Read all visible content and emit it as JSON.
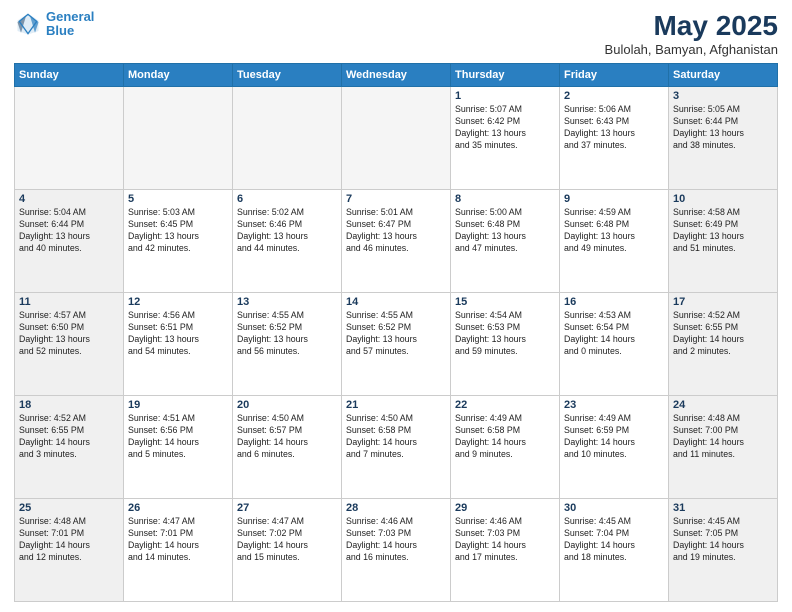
{
  "logo": {
    "line1": "General",
    "line2": "Blue"
  },
  "title": "May 2025",
  "subtitle": "Bulolah, Bamyan, Afghanistan",
  "days_of_week": [
    "Sunday",
    "Monday",
    "Tuesday",
    "Wednesday",
    "Thursday",
    "Friday",
    "Saturday"
  ],
  "weeks": [
    [
      {
        "day": "",
        "info": ""
      },
      {
        "day": "",
        "info": ""
      },
      {
        "day": "",
        "info": ""
      },
      {
        "day": "",
        "info": ""
      },
      {
        "day": "1",
        "info": "Sunrise: 5:07 AM\nSunset: 6:42 PM\nDaylight: 13 hours\nand 35 minutes."
      },
      {
        "day": "2",
        "info": "Sunrise: 5:06 AM\nSunset: 6:43 PM\nDaylight: 13 hours\nand 37 minutes."
      },
      {
        "day": "3",
        "info": "Sunrise: 5:05 AM\nSunset: 6:44 PM\nDaylight: 13 hours\nand 38 minutes."
      }
    ],
    [
      {
        "day": "4",
        "info": "Sunrise: 5:04 AM\nSunset: 6:44 PM\nDaylight: 13 hours\nand 40 minutes."
      },
      {
        "day": "5",
        "info": "Sunrise: 5:03 AM\nSunset: 6:45 PM\nDaylight: 13 hours\nand 42 minutes."
      },
      {
        "day": "6",
        "info": "Sunrise: 5:02 AM\nSunset: 6:46 PM\nDaylight: 13 hours\nand 44 minutes."
      },
      {
        "day": "7",
        "info": "Sunrise: 5:01 AM\nSunset: 6:47 PM\nDaylight: 13 hours\nand 46 minutes."
      },
      {
        "day": "8",
        "info": "Sunrise: 5:00 AM\nSunset: 6:48 PM\nDaylight: 13 hours\nand 47 minutes."
      },
      {
        "day": "9",
        "info": "Sunrise: 4:59 AM\nSunset: 6:48 PM\nDaylight: 13 hours\nand 49 minutes."
      },
      {
        "day": "10",
        "info": "Sunrise: 4:58 AM\nSunset: 6:49 PM\nDaylight: 13 hours\nand 51 minutes."
      }
    ],
    [
      {
        "day": "11",
        "info": "Sunrise: 4:57 AM\nSunset: 6:50 PM\nDaylight: 13 hours\nand 52 minutes."
      },
      {
        "day": "12",
        "info": "Sunrise: 4:56 AM\nSunset: 6:51 PM\nDaylight: 13 hours\nand 54 minutes."
      },
      {
        "day": "13",
        "info": "Sunrise: 4:55 AM\nSunset: 6:52 PM\nDaylight: 13 hours\nand 56 minutes."
      },
      {
        "day": "14",
        "info": "Sunrise: 4:55 AM\nSunset: 6:52 PM\nDaylight: 13 hours\nand 57 minutes."
      },
      {
        "day": "15",
        "info": "Sunrise: 4:54 AM\nSunset: 6:53 PM\nDaylight: 13 hours\nand 59 minutes."
      },
      {
        "day": "16",
        "info": "Sunrise: 4:53 AM\nSunset: 6:54 PM\nDaylight: 14 hours\nand 0 minutes."
      },
      {
        "day": "17",
        "info": "Sunrise: 4:52 AM\nSunset: 6:55 PM\nDaylight: 14 hours\nand 2 minutes."
      }
    ],
    [
      {
        "day": "18",
        "info": "Sunrise: 4:52 AM\nSunset: 6:55 PM\nDaylight: 14 hours\nand 3 minutes."
      },
      {
        "day": "19",
        "info": "Sunrise: 4:51 AM\nSunset: 6:56 PM\nDaylight: 14 hours\nand 5 minutes."
      },
      {
        "day": "20",
        "info": "Sunrise: 4:50 AM\nSunset: 6:57 PM\nDaylight: 14 hours\nand 6 minutes."
      },
      {
        "day": "21",
        "info": "Sunrise: 4:50 AM\nSunset: 6:58 PM\nDaylight: 14 hours\nand 7 minutes."
      },
      {
        "day": "22",
        "info": "Sunrise: 4:49 AM\nSunset: 6:58 PM\nDaylight: 14 hours\nand 9 minutes."
      },
      {
        "day": "23",
        "info": "Sunrise: 4:49 AM\nSunset: 6:59 PM\nDaylight: 14 hours\nand 10 minutes."
      },
      {
        "day": "24",
        "info": "Sunrise: 4:48 AM\nSunset: 7:00 PM\nDaylight: 14 hours\nand 11 minutes."
      }
    ],
    [
      {
        "day": "25",
        "info": "Sunrise: 4:48 AM\nSunset: 7:01 PM\nDaylight: 14 hours\nand 12 minutes."
      },
      {
        "day": "26",
        "info": "Sunrise: 4:47 AM\nSunset: 7:01 PM\nDaylight: 14 hours\nand 14 minutes."
      },
      {
        "day": "27",
        "info": "Sunrise: 4:47 AM\nSunset: 7:02 PM\nDaylight: 14 hours\nand 15 minutes."
      },
      {
        "day": "28",
        "info": "Sunrise: 4:46 AM\nSunset: 7:03 PM\nDaylight: 14 hours\nand 16 minutes."
      },
      {
        "day": "29",
        "info": "Sunrise: 4:46 AM\nSunset: 7:03 PM\nDaylight: 14 hours\nand 17 minutes."
      },
      {
        "day": "30",
        "info": "Sunrise: 4:45 AM\nSunset: 7:04 PM\nDaylight: 14 hours\nand 18 minutes."
      },
      {
        "day": "31",
        "info": "Sunrise: 4:45 AM\nSunset: 7:05 PM\nDaylight: 14 hours\nand 19 minutes."
      }
    ]
  ]
}
